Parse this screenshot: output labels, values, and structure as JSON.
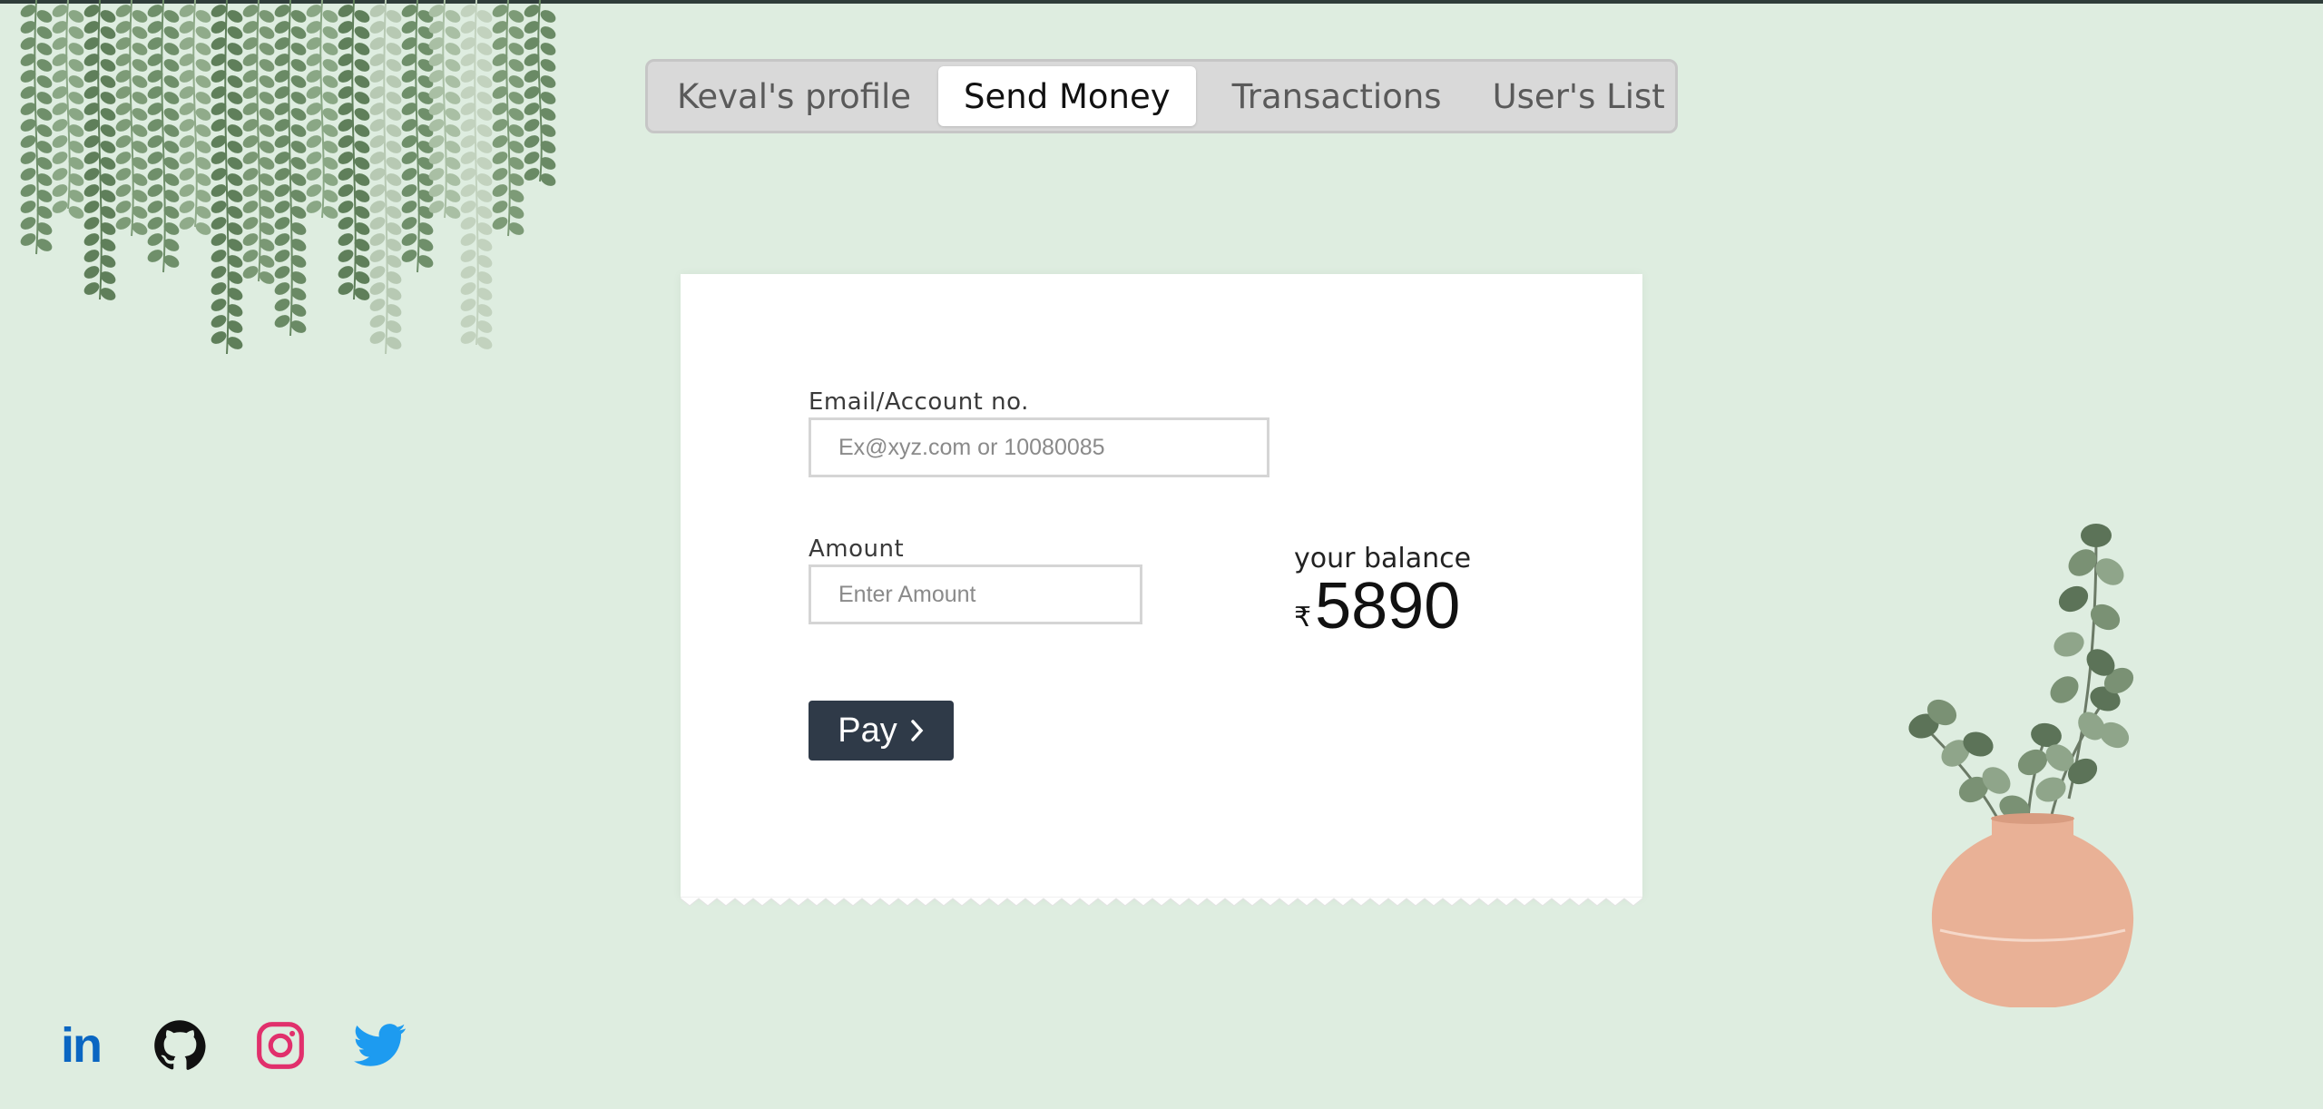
{
  "nav": {
    "tabs": [
      {
        "label": "Keval's profile"
      },
      {
        "label": "Send Money",
        "active": true
      },
      {
        "label": "Transactions"
      },
      {
        "label": "User's List"
      }
    ]
  },
  "form": {
    "email_label": "Email/Account no.",
    "email_placeholder": "Ex@xyz.com or 10080085",
    "amount_label": "Amount",
    "amount_placeholder": "Enter Amount",
    "pay_label": "Pay",
    "pay_icon": "chevron-right-icon"
  },
  "balance": {
    "label": "your balance",
    "currency": "₹",
    "value": "5890"
  },
  "social": {
    "linkedin_label": "in",
    "icons": [
      "linkedin-icon",
      "github-icon",
      "instagram-icon",
      "twitter-icon"
    ]
  },
  "colors": {
    "background": "#deede0",
    "button": "#2f3a48",
    "linkedin": "#0a66c2",
    "instagram": "#e1306c",
    "twitter": "#1d9bf0"
  }
}
